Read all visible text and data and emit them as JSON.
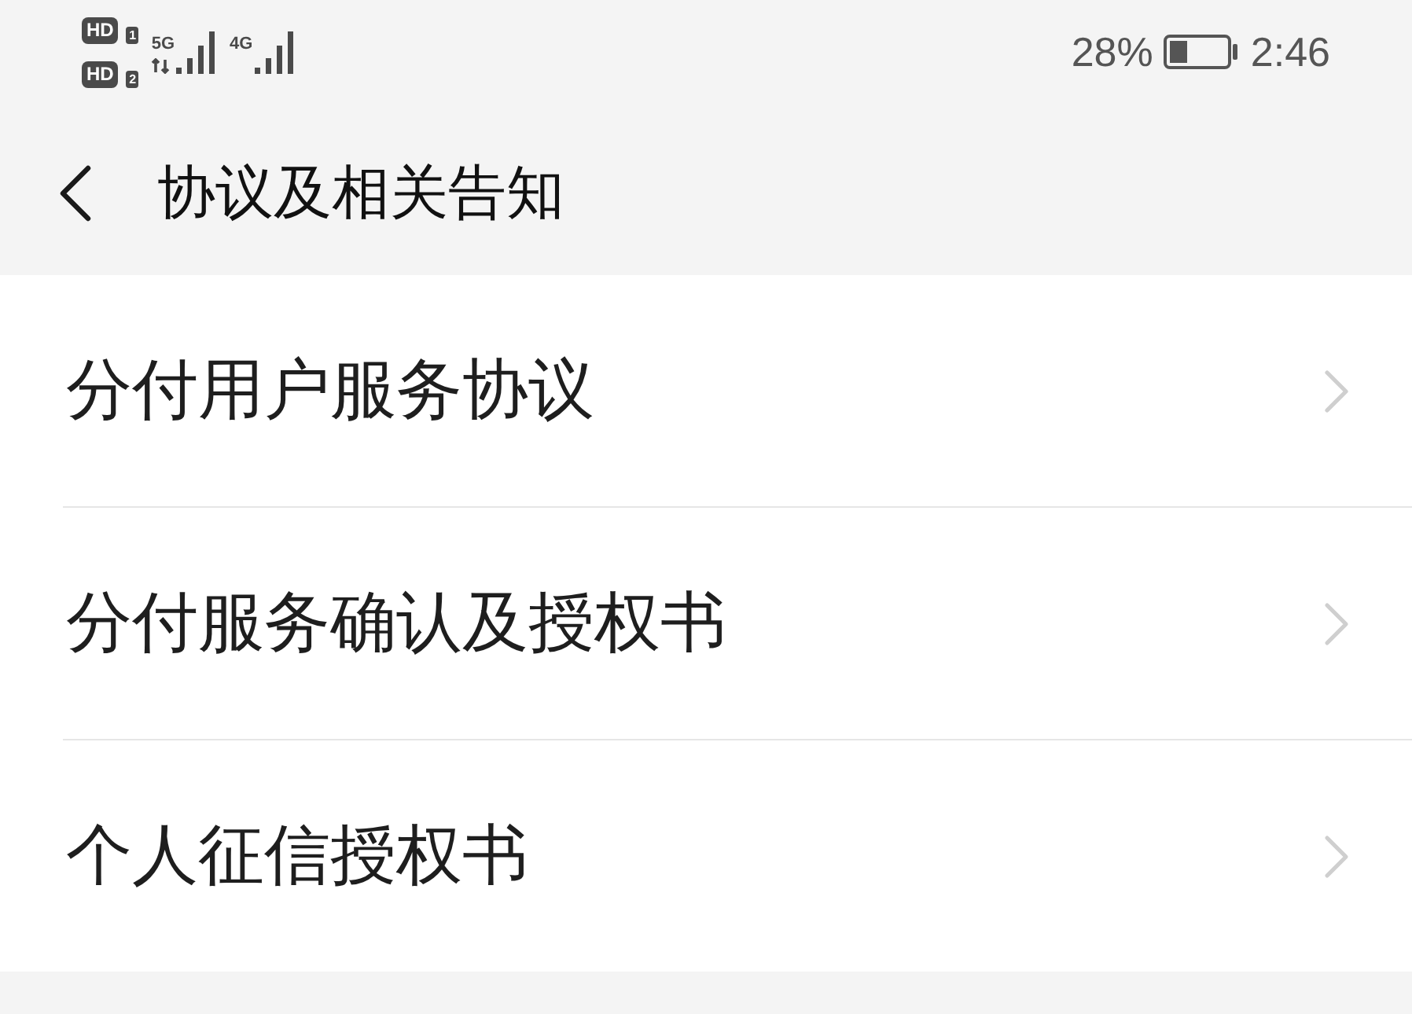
{
  "status_bar": {
    "sim_slots": [
      {
        "badge": "HD",
        "slot": "1"
      },
      {
        "badge": "HD",
        "slot": "2"
      }
    ],
    "networks": [
      {
        "type": "5G",
        "activity": true
      },
      {
        "type": "4G",
        "activity": false
      }
    ],
    "battery_percent": "28%",
    "time": "2:46"
  },
  "header": {
    "title": "协议及相关告知"
  },
  "items": [
    {
      "label": "分付用户服务协议"
    },
    {
      "label": "分付服务确认及授权书"
    },
    {
      "label": "个人征信授权书"
    }
  ]
}
